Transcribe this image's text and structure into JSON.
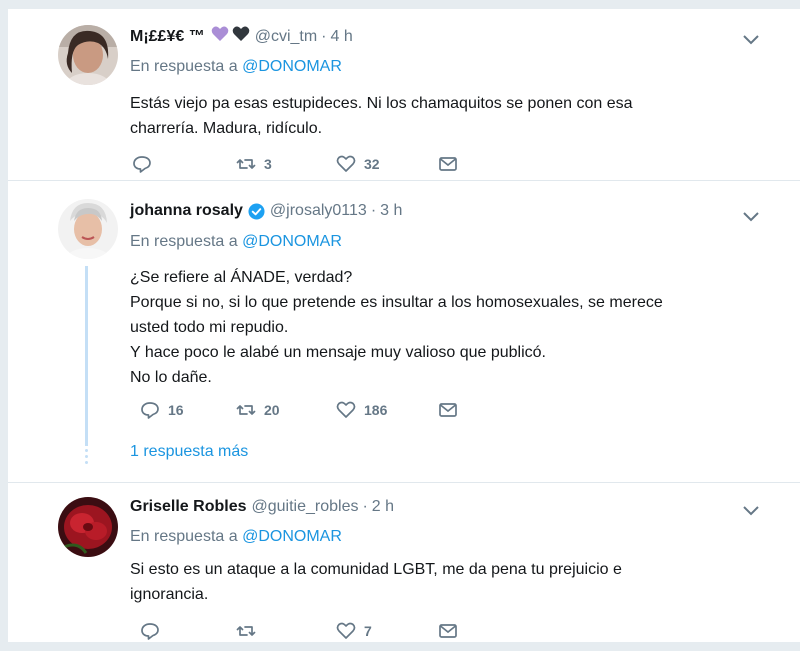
{
  "tweets": [
    {
      "name": "M¡££¥€ ™",
      "handle": "@cvi_tm",
      "dot": "·",
      "time": "4 h",
      "reply_prefix": "En respuesta a ",
      "reply_mention": "@DONOMAR",
      "lines": [
        "Estás viejo pa esas estupideces. Ni los chamaquitos se ponen con esa",
        "charrería. Madura, ridículo."
      ],
      "replies": "",
      "retweets": "3",
      "likes": "32"
    },
    {
      "name": "johanna rosaly",
      "handle": "@jrosaly0113",
      "dot": "·",
      "time": "3 h",
      "reply_prefix": "En respuesta a ",
      "reply_mention": "@DONOMAR",
      "lines": [
        "¿Se refiere al ÁNADE, verdad?",
        "Porque si no, si lo que pretende es insultar a los homosexuales, se merece",
        "usted todo mi repudio.",
        "Y hace poco le alabé un mensaje muy valioso que publicó.",
        "No lo dañe."
      ],
      "replies": "16",
      "retweets": "20",
      "likes": "186",
      "more_replies": "1 respuesta más"
    },
    {
      "name": "Griselle Robles",
      "handle": "@guitie_robles",
      "dot": "·",
      "time": "2 h",
      "reply_prefix": "En respuesta a ",
      "reply_mention": "@DONOMAR",
      "lines": [
        "Si esto es un ataque a la comunidad LGBT, me da pena tu prejuicio e",
        "ignorancia."
      ],
      "replies": "",
      "retweets": "",
      "likes": "7"
    }
  ],
  "colors": {
    "accent": "#1b95e0",
    "muted": "#657786",
    "thread": "#c4dff6",
    "verified": "#1da1f2"
  },
  "icons": [
    "reply-icon",
    "retweet-icon",
    "like-icon",
    "direct-message-icon",
    "chevron-down-icon",
    "verified-badge-icon",
    "purple-heart-emoji",
    "black-heart-emoji"
  ]
}
